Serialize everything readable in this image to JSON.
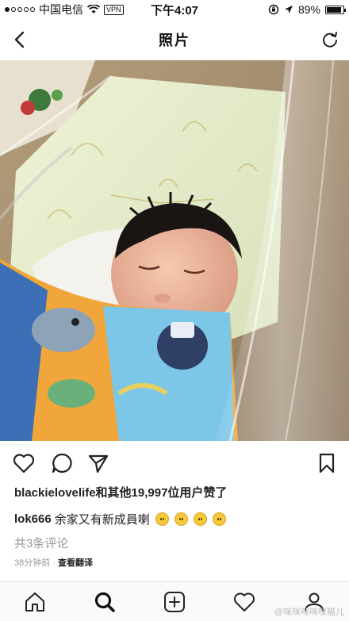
{
  "status_bar": {
    "carrier": "中国电信",
    "vpn_label": "VPN",
    "time": "下午4:07",
    "battery_percent": "89%",
    "battery_level": 0.89
  },
  "nav": {
    "title": "照片",
    "back_icon": "chevron-left-icon",
    "refresh_icon": "refresh-icon"
  },
  "post": {
    "likes_text": "blackielovelife和其他19,997位用户赞了",
    "comment_user": "lok666",
    "comment_text": "余家又有新成員喇",
    "comments_count": "共3条评论",
    "time_ago": "38分钟前",
    "separator": "·",
    "translate_label": "查看翻译"
  },
  "watermark": "@咪咪咪咪咪猫儿"
}
